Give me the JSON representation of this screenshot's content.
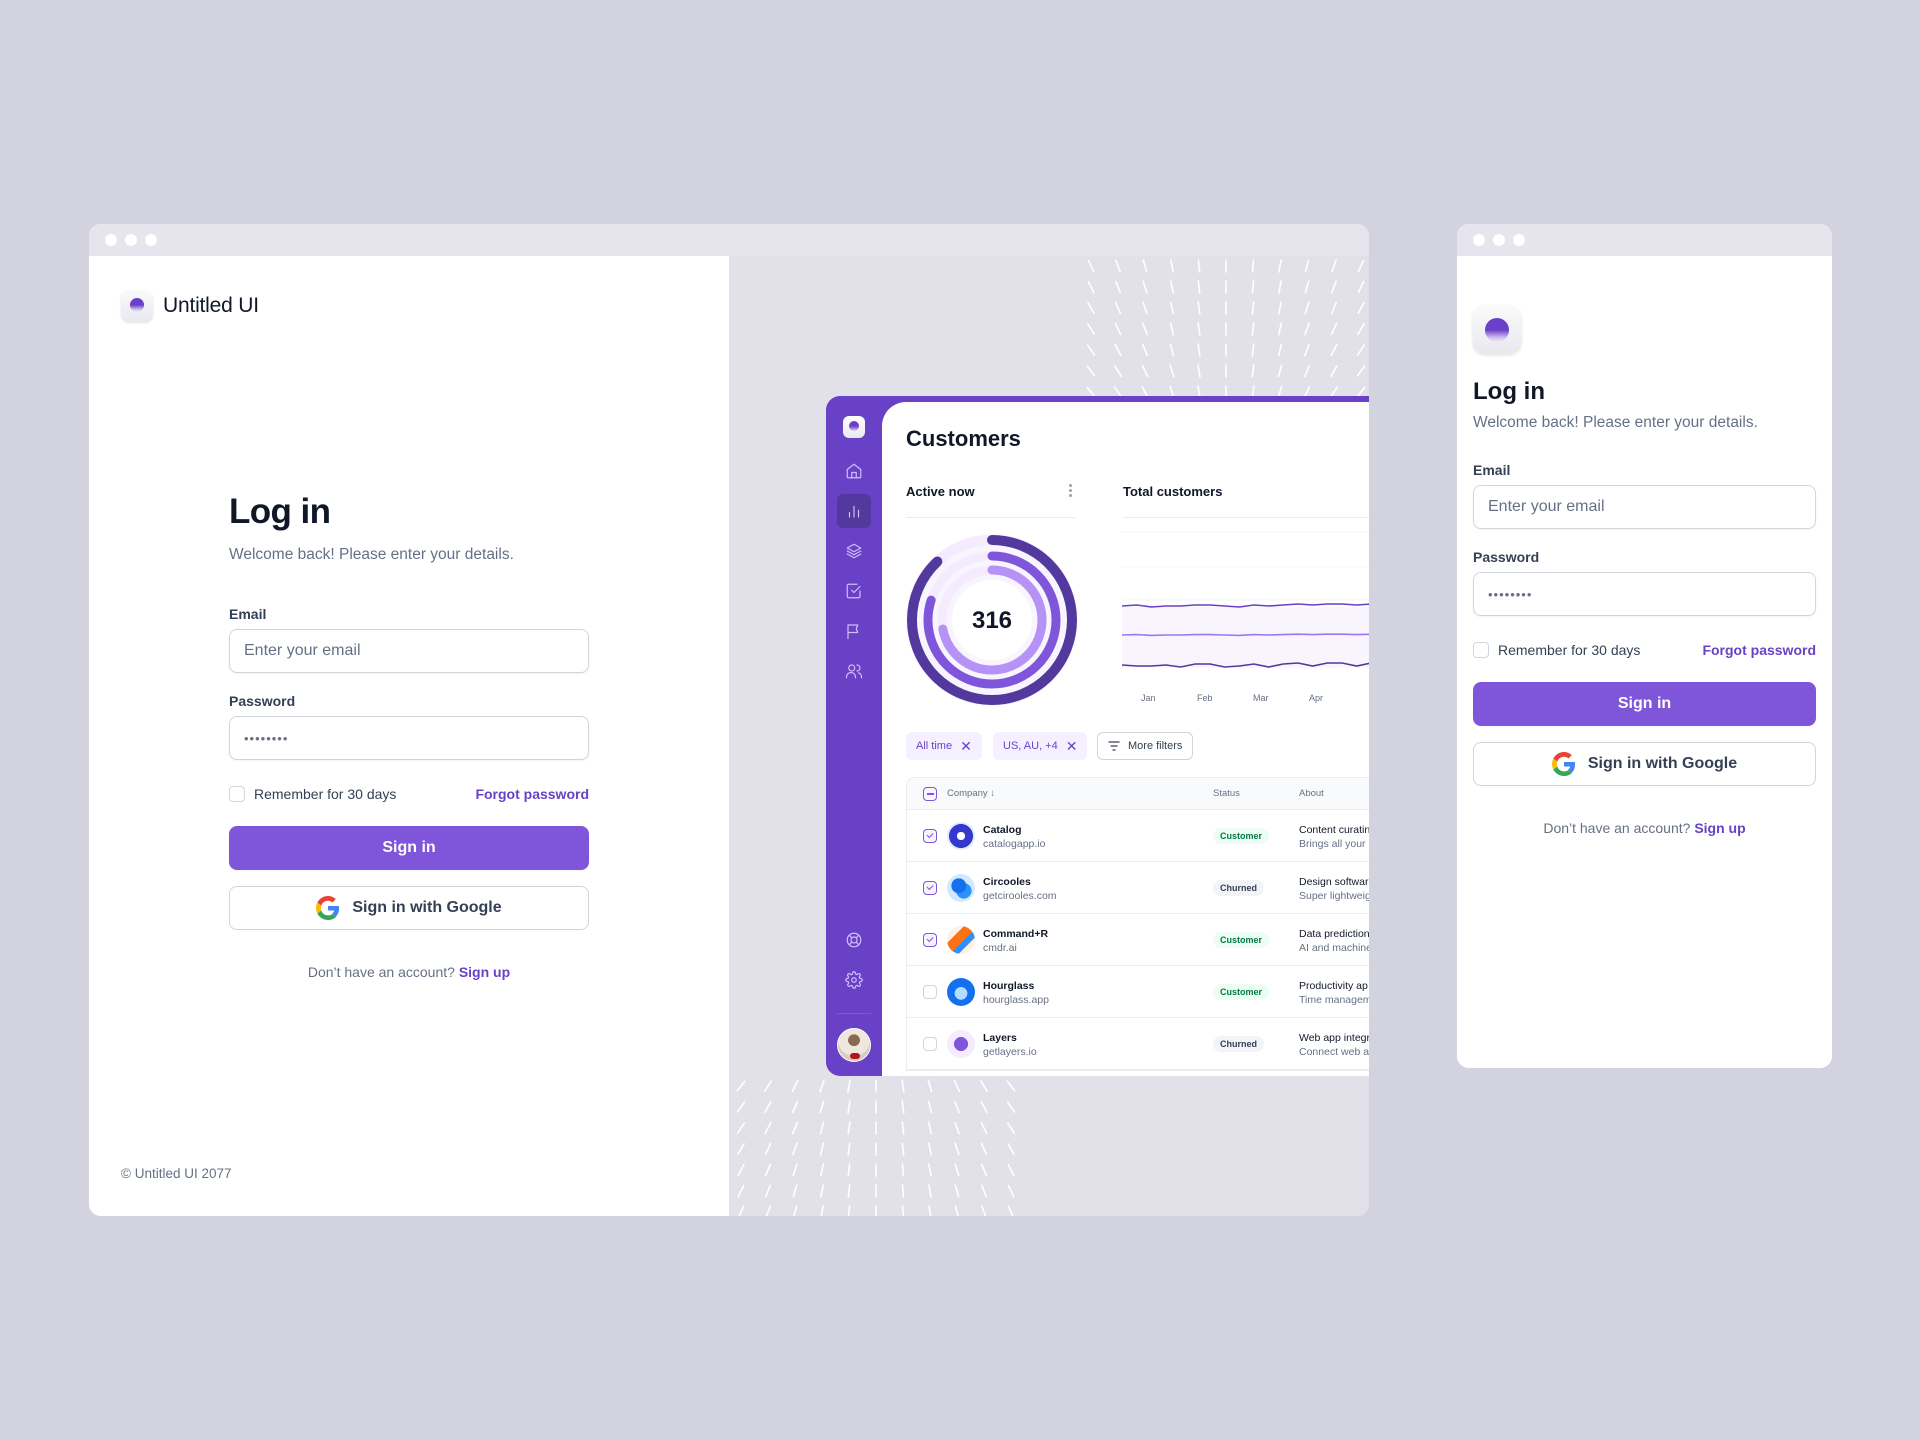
{
  "brand": {
    "name": "Untitled UI"
  },
  "login": {
    "title": "Log in",
    "subtitle": "Welcome back! Please enter your details.",
    "email_label": "Email",
    "email_placeholder": "Enter your email",
    "password_label": "Password",
    "password_value": "••••••••",
    "remember_label": "Remember for 30 days",
    "forgot_label": "Forgot password",
    "sign_in_label": "Sign in",
    "google_label": "Sign in with Google",
    "no_account_text": "Don’t have an account?",
    "sign_up_label": "Sign up"
  },
  "footer": {
    "copyright": "© Untitled UI 2077"
  },
  "dashboard": {
    "title": "Customers",
    "active_now_label": "Active now",
    "active_now_value": "316",
    "total_customers_label": "Total customers",
    "months": [
      "Jan",
      "Feb",
      "Mar",
      "Apr"
    ],
    "filters": [
      {
        "label": "All time",
        "removable": true
      },
      {
        "label": "US, AU, +4",
        "removable": true
      },
      {
        "label": "More filters",
        "removable": false
      }
    ],
    "table": {
      "headers": {
        "company": "Company",
        "status": "Status",
        "about": "About"
      },
      "rows": [
        {
          "checked": true,
          "name": "Catalog",
          "url": "catalogapp.io",
          "status": "Customer",
          "about_title": "Content curatin",
          "about_desc": "Brings all your"
        },
        {
          "checked": true,
          "name": "Circooles",
          "url": "getcirooles.com",
          "status": "Churned",
          "about_title": "Design softwar",
          "about_desc": "Super lightweig"
        },
        {
          "checked": true,
          "name": "Command+R",
          "url": "cmdr.ai",
          "status": "Customer",
          "about_title": "Data prediction",
          "about_desc": "AI and machine"
        },
        {
          "checked": false,
          "name": "Hourglass",
          "url": "hourglass.app",
          "status": "Customer",
          "about_title": "Productivity ap",
          "about_desc": "Time managem"
        },
        {
          "checked": false,
          "name": "Layers",
          "url": "getlayers.io",
          "status": "Churned",
          "about_title": "Web app integr",
          "about_desc": "Connect web a"
        }
      ]
    }
  },
  "colors": {
    "primary": "#7f56d9",
    "primary_dark": "#6941c6",
    "background": "#d3d2df"
  }
}
